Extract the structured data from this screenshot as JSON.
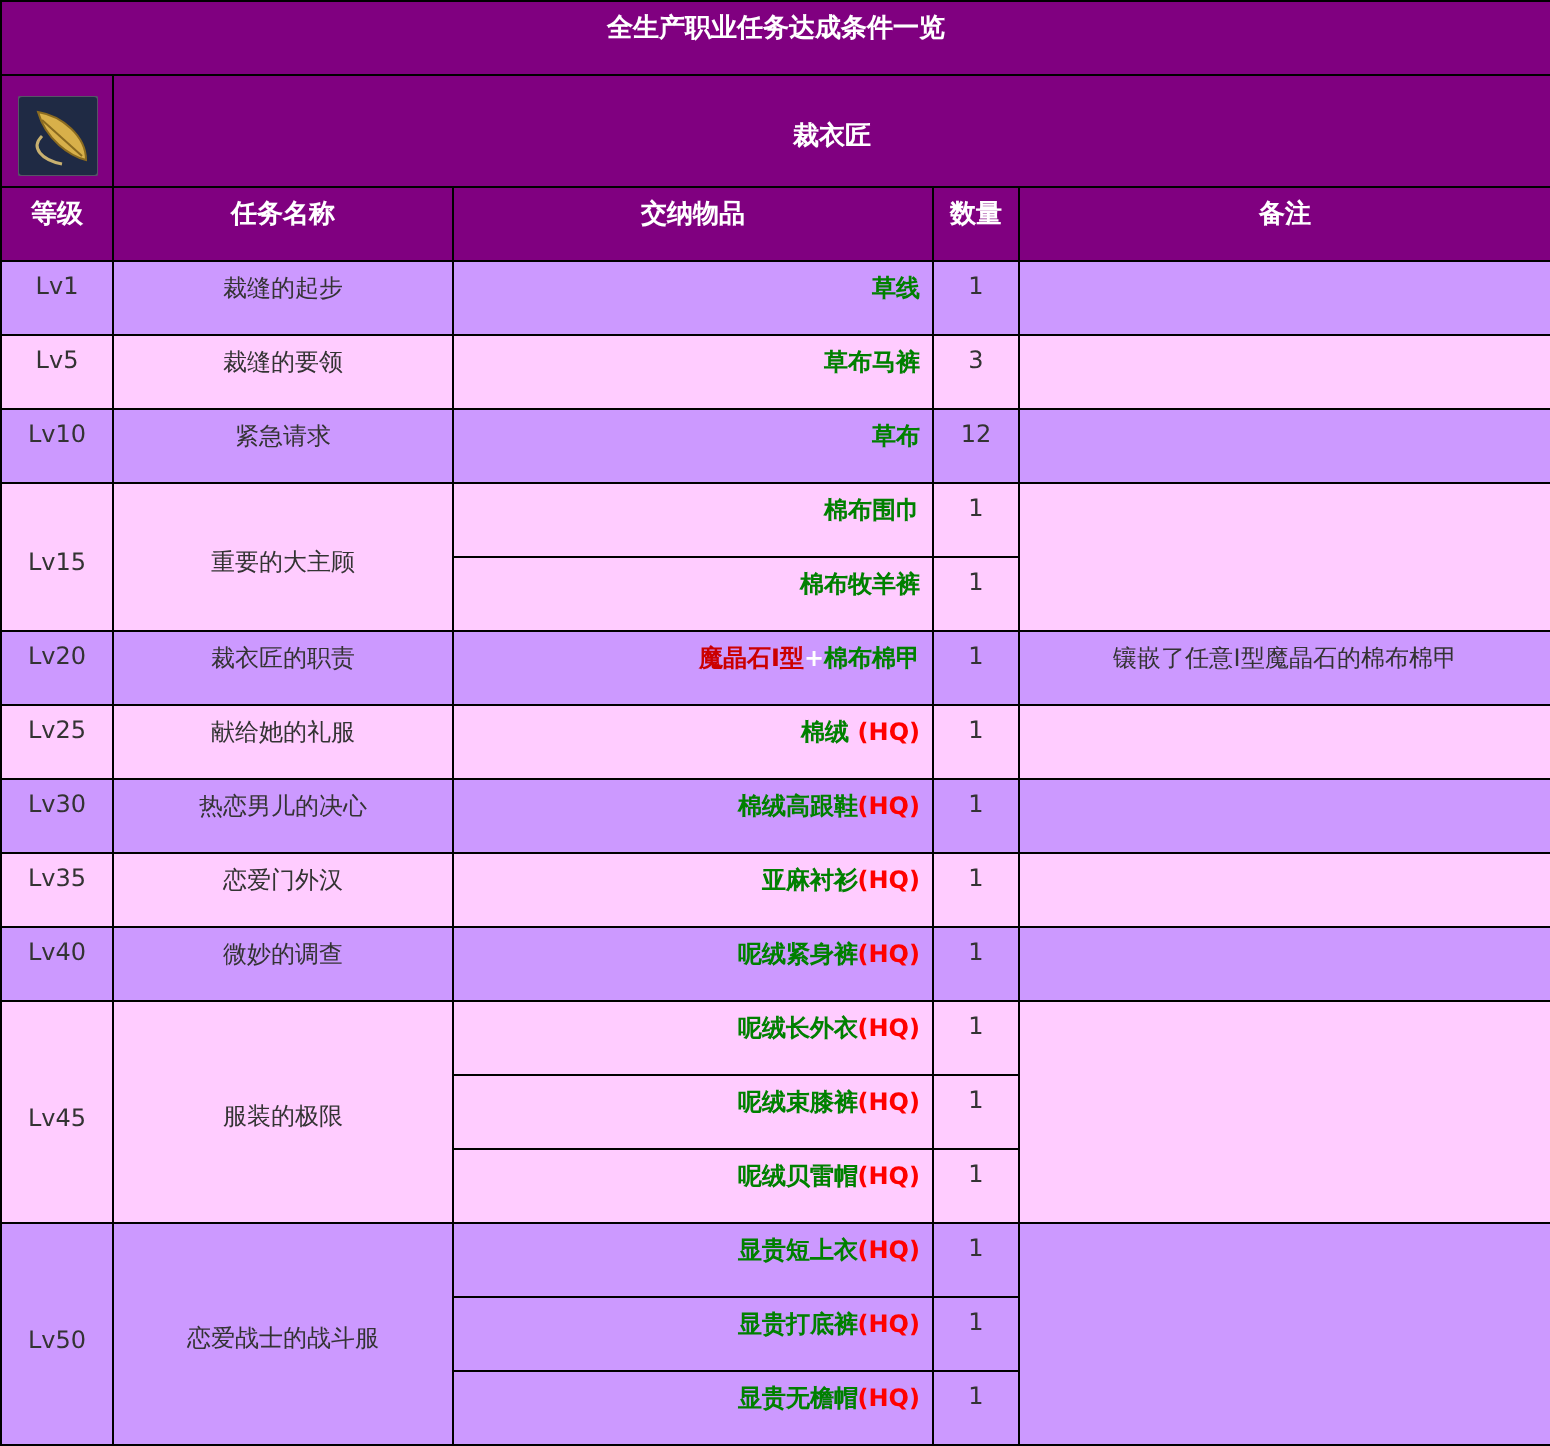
{
  "title": "全生产职业任务达成条件一览",
  "job": {
    "name": "裁衣匠"
  },
  "columns": [
    "等级",
    "任务名称",
    "交纳物品",
    "数量",
    "备注"
  ],
  "rows": [
    {
      "level": "Lv1",
      "quest": "裁缝的起步",
      "items": [
        {
          "parts": [
            {
              "text": "草线",
              "kind": "item"
            }
          ],
          "count": "1"
        }
      ]
    },
    {
      "level": "Lv5",
      "quest": "裁缝的要领",
      "items": [
        {
          "parts": [
            {
              "text": "草布马裤",
              "kind": "item"
            }
          ],
          "count": "3"
        }
      ]
    },
    {
      "level": "Lv10",
      "quest": "紧急请求",
      "items": [
        {
          "parts": [
            {
              "text": "草布",
              "kind": "item"
            }
          ],
          "count": "12"
        }
      ]
    },
    {
      "level": "Lv15",
      "quest": "重要的大主顾",
      "items": [
        {
          "parts": [
            {
              "text": "棉布围巾",
              "kind": "item"
            }
          ],
          "count": "1"
        },
        {
          "parts": [
            {
              "text": "棉布牧羊裤",
              "kind": "item"
            }
          ],
          "count": "1"
        }
      ]
    },
    {
      "level": "Lv20",
      "quest": "裁衣匠的职责",
      "items": [
        {
          "parts": [
            {
              "text": "魔晶石Ⅰ型",
              "kind": "material"
            },
            {
              "text": "+",
              "kind": "plus"
            },
            {
              "text": "棉布棉甲",
              "kind": "item"
            }
          ],
          "count": "1"
        }
      ],
      "note": "镶嵌了任意Ⅰ型魔晶石的棉布棉甲"
    },
    {
      "level": "Lv25",
      "quest": "献给她的礼服",
      "items": [
        {
          "parts": [
            {
              "text": "棉绒",
              "kind": "item"
            },
            {
              "text": " (HQ)",
              "kind": "hq"
            }
          ],
          "count": "1"
        }
      ]
    },
    {
      "level": "Lv30",
      "quest": "热恋男儿的决心",
      "items": [
        {
          "parts": [
            {
              "text": "棉绒高跟鞋",
              "kind": "item"
            },
            {
              "text": "(HQ)",
              "kind": "hq"
            }
          ],
          "count": "1"
        }
      ]
    },
    {
      "level": "Lv35",
      "quest": "恋爱门外汉",
      "items": [
        {
          "parts": [
            {
              "text": "亚麻衬衫",
              "kind": "item"
            },
            {
              "text": "(HQ)",
              "kind": "hq"
            }
          ],
          "count": "1"
        }
      ]
    },
    {
      "level": "Lv40",
      "quest": "微妙的调查",
      "items": [
        {
          "parts": [
            {
              "text": "呢绒紧身裤",
              "kind": "item"
            },
            {
              "text": "(HQ)",
              "kind": "hq"
            }
          ],
          "count": "1"
        }
      ]
    },
    {
      "level": "Lv45",
      "quest": "服装的极限",
      "items": [
        {
          "parts": [
            {
              "text": "呢绒长外衣",
              "kind": "item"
            },
            {
              "text": "(HQ)",
              "kind": "hq"
            }
          ],
          "count": "1"
        },
        {
          "parts": [
            {
              "text": "呢绒束膝裤",
              "kind": "item"
            },
            {
              "text": "(HQ)",
              "kind": "hq"
            }
          ],
          "count": "1"
        },
        {
          "parts": [
            {
              "text": "呢绒贝雷帽",
              "kind": "item"
            },
            {
              "text": "(HQ)",
              "kind": "hq"
            }
          ],
          "count": "1"
        }
      ]
    },
    {
      "level": "Lv50",
      "quest": "恋爱战士的战斗服",
      "items": [
        {
          "parts": [
            {
              "text": "显贵短上衣",
              "kind": "item"
            },
            {
              "text": "(HQ)",
              "kind": "hq"
            }
          ],
          "count": "1"
        },
        {
          "parts": [
            {
              "text": "显贵打底裤",
              "kind": "item"
            },
            {
              "text": "(HQ)",
              "kind": "hq"
            }
          ],
          "count": "1"
        },
        {
          "parts": [
            {
              "text": "显贵无檐帽",
              "kind": "item"
            },
            {
              "text": "(HQ)",
              "kind": "hq"
            }
          ],
          "count": "1"
        }
      ]
    }
  ]
}
